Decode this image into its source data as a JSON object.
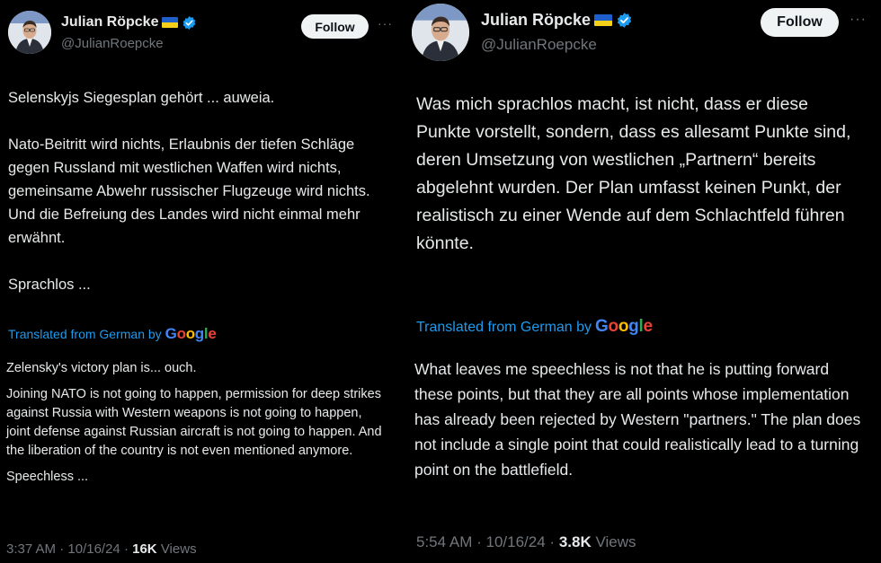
{
  "tweets": [
    {
      "author": {
        "name": "Julian Röpcke",
        "handle": "@JulianRoepcke",
        "flag": "ukraine-flag",
        "verified_badge": "verified-badge-icon"
      },
      "follow_label": "Follow",
      "more_label": "···",
      "original_paragraphs": [
        "Selenskyjs Siegesplan gehört ... auweia.",
        "Nato-Beitritt wird nichts, Erlaubnis der tiefen Schläge gegen Russland mit westlichen Waffen wird nichts, gemeinsame Abwehr russischer Flugzeuge wird nichts. Und die Befreiung des Landes wird nicht einmal mehr erwähnt.",
        "Sprachlos ..."
      ],
      "translated_label": "Translated from German by",
      "translated_by": "Google",
      "translation_paragraphs": [
        "Zelensky's victory plan is... ouch.",
        "Joining NATO is not going to happen, permission for deep strikes against Russia with Western weapons is not going to happen, joint defense against Russian aircraft is not going to happen. And the liberation of the country is not even mentioned anymore.",
        "Speechless ..."
      ],
      "time": "3:37 AM",
      "date": "10/16/24",
      "views_count": "16K",
      "views_label": "Views"
    },
    {
      "author": {
        "name": "Julian Röpcke",
        "handle": "@JulianRoepcke",
        "flag": "ukraine-flag",
        "verified_badge": "verified-badge-icon"
      },
      "follow_label": "Follow",
      "more_label": "···",
      "original_paragraphs": [
        "Was mich sprachlos macht, ist nicht, dass er diese Punkte vorstellt, sondern, dass es allesamt Punkte sind, deren Umsetzung von westlichen „Partnern“ bereits abgelehnt wurden. Der Plan umfasst keinen Punkt, der realistisch zu einer Wende auf dem Schlachtfeld führen könnte."
      ],
      "translated_label": "Translated from German by",
      "translated_by": "Google",
      "translation_paragraphs": [
        "What leaves me speechless is not that he is putting forward these points, but that they are all points whose implementation has already been rejected by Western \"partners.\" The plan does not include a single point that could realistically lead to a turning point on the battlefield."
      ],
      "time": "5:54 AM",
      "date": "10/16/24",
      "views_count": "3.8K",
      "views_label": "Views"
    }
  ],
  "colors": {
    "background": "#000000",
    "text_primary": "#e7e9ea",
    "text_secondary": "#71767b",
    "link": "#1d9bf0",
    "verified": "#1d9bf0",
    "follow_bg": "#eff3f4"
  }
}
